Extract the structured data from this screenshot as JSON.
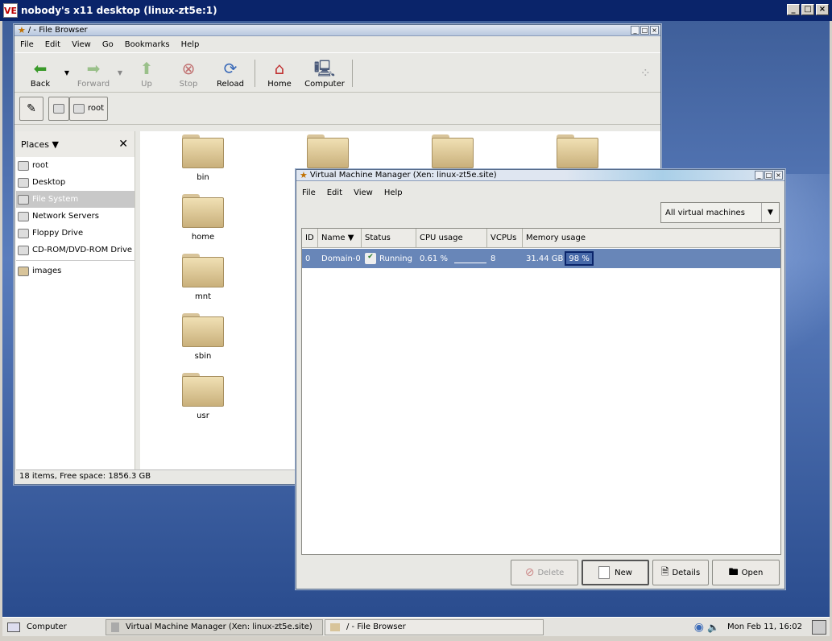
{
  "vnc": {
    "title": "nobody's x11 desktop (linux-zt5e:1)",
    "logo": "VE"
  },
  "file_browser": {
    "title": "/ - File Browser",
    "menu": [
      "File",
      "Edit",
      "View",
      "Go",
      "Bookmarks",
      "Help"
    ],
    "toolbar": {
      "back": "Back",
      "forward": "Forward",
      "up": "Up",
      "stop": "Stop",
      "reload": "Reload",
      "home": "Home",
      "computer": "Computer"
    },
    "location": {
      "root": "root"
    },
    "places_label": "Places",
    "places": [
      {
        "label": "root",
        "icon": "home-folder-icon"
      },
      {
        "label": "Desktop",
        "icon": "desktop-icon"
      },
      {
        "label": "File System",
        "icon": "drive-icon"
      },
      {
        "label": "Network Servers",
        "icon": "network-icon"
      },
      {
        "label": "Floppy Drive",
        "icon": "floppy-icon"
      },
      {
        "label": "CD-ROM/DVD-ROM Drive",
        "icon": "cdrom-icon"
      },
      {
        "label": "images",
        "icon": "folder-icon"
      }
    ],
    "folders": [
      "bin",
      "home",
      "mnt",
      "sbin",
      "usr"
    ],
    "status": "18 items, Free space: 1856.3 GB"
  },
  "vmm": {
    "title": "Virtual Machine Manager (Xen: linux-zt5e.site)",
    "menu": [
      "File",
      "Edit",
      "View",
      "Help"
    ],
    "filter": "All virtual machines",
    "columns": [
      "ID",
      "Name",
      "Status",
      "CPU usage",
      "VCPUs",
      "Memory usage"
    ],
    "rows": [
      {
        "id": "0",
        "name": "Domain-0",
        "status": "Running",
        "cpu": "0.61 %",
        "vcpus": "8",
        "memory": "31.44 GB",
        "memory_pct": "98 %"
      }
    ],
    "buttons": {
      "delete": "Delete",
      "new": "New",
      "details": "Details",
      "open": "Open"
    }
  },
  "taskbar": {
    "computer": "Computer",
    "tasks": [
      "Virtual Machine Manager (Xen: linux-zt5e.site)",
      "/ - File Browser"
    ],
    "clock": "Mon Feb 11, 16:02"
  }
}
